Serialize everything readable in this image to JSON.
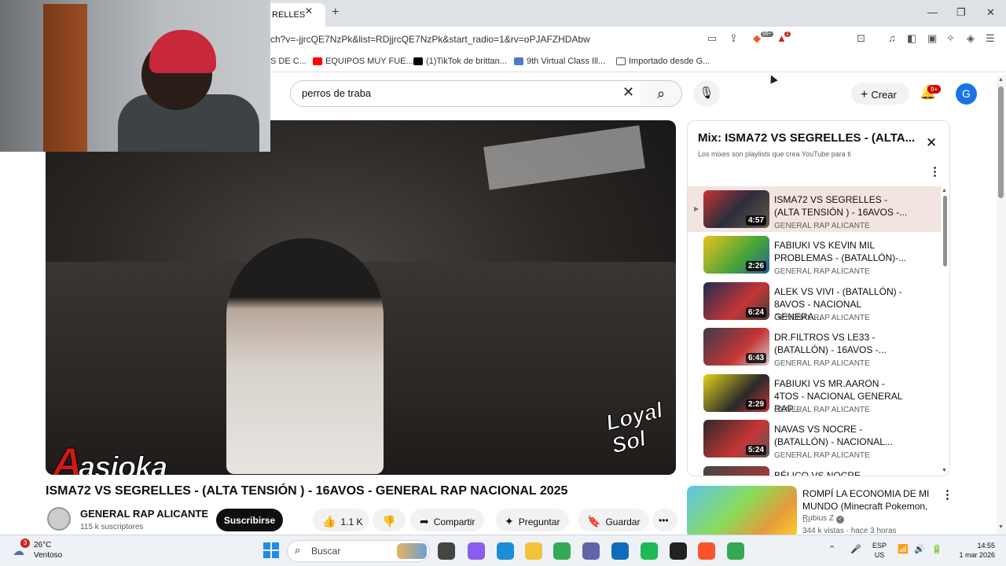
{
  "browser": {
    "tab_title": "RELLES",
    "url": "ch?v=-jjrcQE7NzPk&list=RDjjrcQE7NzPk&start_radio=1&rv=oPJAFZHDAbw",
    "ext_badges": [
      "99+",
      "1"
    ],
    "bookmarks": [
      {
        "label": "S DE C...",
        "color": "#999999"
      },
      {
        "label": "EQUIPOS MUY FUE...",
        "color": "#ff0000"
      },
      {
        "label": "(1)TikTok de brittan...",
        "color": "#000000"
      },
      {
        "label": "9th Virtual Class Ill...",
        "color": "#4a7bd0"
      },
      {
        "label": "Importado desde G...",
        "color": "#f0c040"
      }
    ]
  },
  "youtube": {
    "search_value": "perros de traba",
    "create_label": "Crear",
    "notifications_badge": "9+",
    "avatar_letter": "G"
  },
  "video": {
    "watermark_left": "asioka",
    "watermark_right": "Loyal Sol",
    "title": "ISMA72 VS SEGRELLES - (ALTA TENSIÓN ) - 16AVOS - GENERAL RAP NACIONAL 2025",
    "channel": "GENERAL RAP ALICANTE",
    "subscribers": "115 k suscriptores",
    "subscribe_label": "Suscribirse",
    "likes": "1.1 K",
    "share_label": "Compartir",
    "ask_label": "Preguntar",
    "save_label": "Guardar"
  },
  "playlist": {
    "title": "Mix: ISMA72 VS SEGRELLES - (ALTA...",
    "subtitle": "Los mixes son playlists que crea YouTube para ti",
    "items": [
      {
        "title": "ISMA72 VS SEGRELLES - (ALTA TENSIÓN ) - 16AVOS -...",
        "channel": "GENERAL RAP ALICANTE",
        "duration": "4:57",
        "active": true
      },
      {
        "title": "FABIUKI VS KEVIN MIL PROBLEMAS - (BATALLÓN)-...",
        "channel": "GENERAL RAP ALICANTE",
        "duration": "2:26",
        "active": false
      },
      {
        "title": "ALEK VS VIVI - (BATALLÓN) - 8AVOS - NACIONAL GENERA...",
        "channel": "GENERAL RAP ALICANTE",
        "duration": "6:24",
        "active": false
      },
      {
        "title": "DR.FILTROS VS LE33 - (BATALLÓN) - 16AVOS -...",
        "channel": "GENERAL RAP ALICANTE",
        "duration": "6:43",
        "active": false
      },
      {
        "title": "FABIUKI VS MR.AARON - 4TOS - NACIONAL GENERAL RAP...",
        "channel": "GENERAL RAP ALICANTE",
        "duration": "2:29",
        "active": false
      },
      {
        "title": "NAVAS VS NOCRE - (BATALLÓN) - NACIONAL...",
        "channel": "GENERAL RAP ALICANTE",
        "duration": "5:24",
        "active": false
      },
      {
        "title": "BÉLICO VS NOCRE -",
        "channel": "",
        "duration": "",
        "active": false
      }
    ]
  },
  "recommendation": {
    "title": "ROMPÍ LA ECONOMIA DE MI MUNDO (Minecraft Pokemon, ...",
    "channel": "Rubius Z",
    "meta": "344 k vistas · hace 3 horas"
  },
  "taskbar": {
    "weather_temp": "26°C",
    "weather_desc": "Ventoso",
    "weather_badge": "3",
    "search_placeholder": "Buscar",
    "lang_top": "ESP",
    "lang_bottom": "US",
    "time": "14:55",
    "date": "1 mar 2026",
    "apps": [
      {
        "name": "file-explorer-dark",
        "color": "#444444"
      },
      {
        "name": "copilot",
        "color": "#8a5cf0"
      },
      {
        "name": "edge",
        "color": "#1a8fd8"
      },
      {
        "name": "folder",
        "color": "#f3c23c"
      },
      {
        "name": "chrome",
        "color": "#34a853"
      },
      {
        "name": "teams",
        "color": "#6264a7"
      },
      {
        "name": "outlook",
        "color": "#0f6cbd"
      },
      {
        "name": "spotify",
        "color": "#1db954"
      },
      {
        "name": "github",
        "color": "#222222"
      },
      {
        "name": "brave",
        "color": "#fb542b"
      },
      {
        "name": "chrome-2",
        "color": "#34a853"
      }
    ]
  }
}
